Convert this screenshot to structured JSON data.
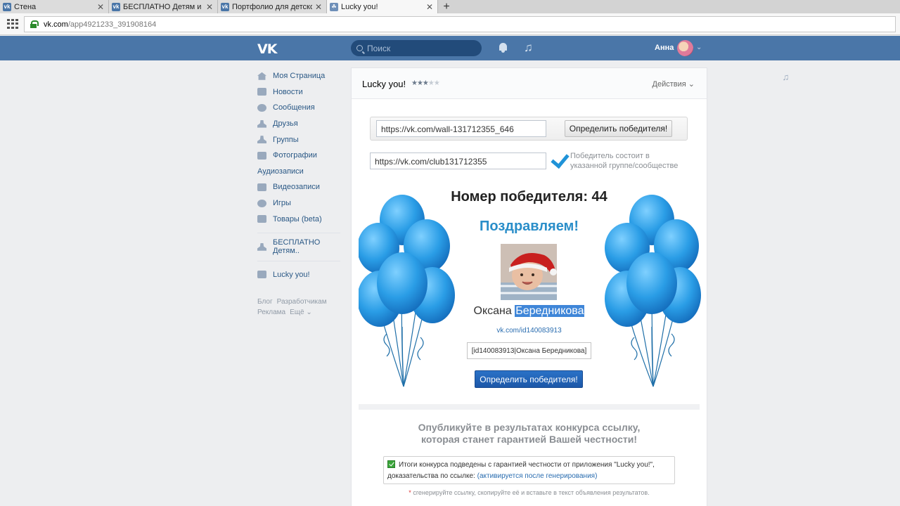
{
  "browser": {
    "tabs": [
      {
        "title": "Стена",
        "favicon": "vk-icon"
      },
      {
        "title": "БЕСПЛАТНО Детям и ро…",
        "favicon": "vk-icon"
      },
      {
        "title": "Портфолио для детского",
        "favicon": "vk-icon"
      },
      {
        "title": "Lucky you!",
        "favicon": "app-icon"
      }
    ],
    "new_tab": "+",
    "url_host": "vk.com",
    "url_path": "/app4921233_391908164"
  },
  "header": {
    "logo": "VK",
    "search_placeholder": "Поиск",
    "user_name": "Анна"
  },
  "menu": {
    "items": [
      {
        "label": "Моя Страница",
        "icon": "home-icon"
      },
      {
        "label": "Новости",
        "icon": "news-icon"
      },
      {
        "label": "Сообщения",
        "icon": "messages-icon"
      },
      {
        "label": "Друзья",
        "icon": "friend-icon"
      },
      {
        "label": "Группы",
        "icon": "groups-icon"
      },
      {
        "label": "Фотографии",
        "icon": "camera-icon"
      },
      {
        "label": "Аудиозаписи",
        "icon": "music-icon"
      },
      {
        "label": "Видеозаписи",
        "icon": "video-icon"
      },
      {
        "label": "Игры",
        "icon": "gamepad-icon"
      },
      {
        "label": "Товары (beta)",
        "icon": "bag-icon"
      }
    ],
    "group_item": "БЕСПЛАТНО Детям..",
    "app_item": "Lucky you!",
    "footer": [
      "Блог",
      "Разработчикам",
      "Реклама",
      "Ещё ⌄"
    ]
  },
  "app": {
    "title": "Lucky you!",
    "rating": 3,
    "rating_max": 5,
    "actions_label": "Действия ⌄",
    "post_url": "https://vk.com/wall-131712355_646",
    "determine_btn": "Определить победителя!",
    "group_url": "https://vk.com/club131712355",
    "group_note_line1": "Победитель состоит в",
    "group_note_line2": "указанной группе/сообществе",
    "winner_number_label": "Номер победителя: 44",
    "congrats": "Поздравляем!",
    "winner_first": "Оксана",
    "winner_last": "Бередникова",
    "winner_link": "vk.com/id140083913",
    "winner_code": "[id140083913|Оксана Бередникова]",
    "determine_btn2": "Определить победителя!",
    "publish_line1": "Опубликуйте в результатах конкурса ссылку,",
    "publish_line2": "которая станет гарантией Вашей честности!",
    "proof_text": "Итоги конкурса подведены с гарантией честности от приложения \"Lucky you!\",",
    "proof_text2": "доказательства по ссылке:",
    "proof_link": "(активируется после генерирования)",
    "hint_star": "*",
    "hint": "сгенерируйте ссылку, скопируйте её и вставьте в текст объявления результатов."
  }
}
